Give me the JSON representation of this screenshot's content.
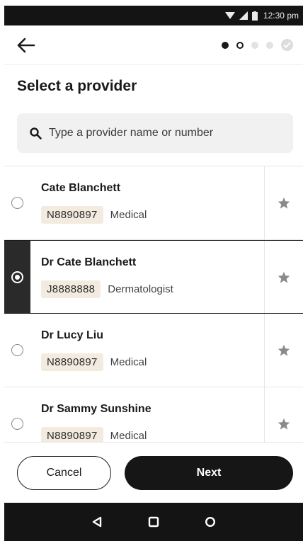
{
  "status_bar": {
    "time": "12:30 pm",
    "icons": [
      "wifi-icon",
      "signal-icon",
      "battery-icon"
    ]
  },
  "header": {
    "back_icon": "arrow-left-icon",
    "steps": [
      "complete",
      "current",
      "pending",
      "pending",
      "done-check"
    ]
  },
  "page": {
    "title": "Select a provider"
  },
  "search": {
    "placeholder": "Type a provider name or number",
    "icon": "search-icon"
  },
  "providers": [
    {
      "name": "Cate Blanchett",
      "number": "N8890897",
      "type": "Medical",
      "selected": false
    },
    {
      "name": "Dr Cate Blanchett",
      "number": "J8888888",
      "type": "Dermatologist",
      "selected": true
    },
    {
      "name": "Dr Lucy Liu",
      "number": "N8890897",
      "type": "Medical",
      "selected": false
    },
    {
      "name": "Dr Sammy Sunshine",
      "number": "N8890897",
      "type": "Medical",
      "selected": false
    }
  ],
  "footer": {
    "cancel_label": "Cancel",
    "next_label": "Next"
  },
  "system_nav": [
    "back-triangle-icon",
    "home-square-icon",
    "recents-circle-icon"
  ],
  "colors": {
    "dark": "#161616",
    "code_chip_bg": "#f3ebe0",
    "search_bg": "#f1f1f1"
  }
}
